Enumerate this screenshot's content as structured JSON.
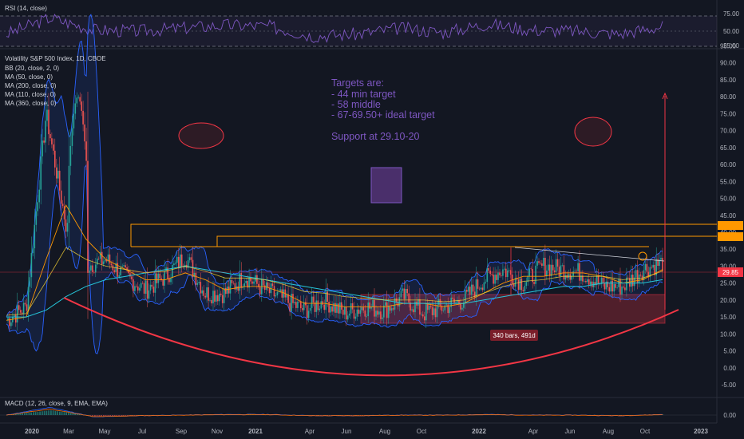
{
  "rsi_panel": {
    "legend": "RSI (14, close)",
    "ticks": [
      "75.00",
      "50.00",
      "25.00"
    ]
  },
  "main_panel": {
    "legend_title": "Volatility S&P 500 Index, 1D, CBOE",
    "indicators": [
      "BB (20, close, 2, 0)",
      "MA (50, close, 0)",
      "MA (200, close, 0)",
      "MA (110, close, 0)",
      "MA (360, close, 0)"
    ],
    "annotation_lines": [
      "Targets are:",
      "- 44 min target",
      "- 58 middle",
      "- 67-69.50+ ideal target",
      "",
      "Support at 29.10-20"
    ],
    "range_label": "340 bars, 491d",
    "price_tags": [
      {
        "text": "29.85",
        "color": "#f23645"
      },
      {
        "text": "",
        "color": "#ff9800"
      },
      {
        "text": "",
        "color": "#ff9800"
      }
    ]
  },
  "macd_panel": {
    "legend": "MACD (12, 26, close, 9, EMA, EMA)",
    "tick": "0.00"
  },
  "x_axis": {
    "labels": [
      "2020",
      "Mar",
      "May",
      "Jul",
      "Sep",
      "Nov",
      "2021",
      "Apr",
      "Jun",
      "Aug",
      "Oct",
      "2022",
      "Apr",
      "Jun",
      "Aug",
      "Oct",
      "2023"
    ]
  },
  "colors": {
    "background": "#131722",
    "axis_text": "#b2b5be",
    "annotation": "#7e57c2",
    "resistance": "#ff9800",
    "support_arc": "#f23645",
    "bollinger": "#2962ff",
    "up_candle": "#26a69a",
    "down_candle": "#ef5350"
  },
  "chart_data": [
    {
      "type": "line",
      "title": "",
      "legend": [
        "RSI (14, close)"
      ],
      "ylim": [
        20,
        85
      ],
      "yticks": [
        75,
        50,
        25
      ],
      "series": [
        {
          "name": "RSI (14, close)",
          "x": [
            "2020-01",
            "2020-03",
            "2020-05",
            "2020-07",
            "2020-09",
            "2020-11",
            "2021-01",
            "2021-04",
            "2021-06",
            "2021-08",
            "2021-10",
            "2022-01",
            "2022-04",
            "2022-06",
            "2022-08",
            "2022-10"
          ],
          "y": [
            45,
            72,
            52,
            50,
            55,
            60,
            58,
            42,
            45,
            55,
            48,
            62,
            52,
            50,
            45,
            58
          ]
        }
      ]
    },
    {
      "type": "line",
      "title": "Volatility S&P 500 Index, 1D, CBOE",
      "ylim": [
        -5,
        95
      ],
      "yticks": [
        95,
        90,
        85,
        80,
        75,
        70,
        65,
        60,
        55,
        50,
        45,
        40,
        35,
        30,
        25,
        20,
        15,
        10,
        5,
        0,
        -5
      ],
      "x": [
        "2020-01",
        "2020-02",
        "2020-03",
        "2020-04",
        "2020-05",
        "2020-06",
        "2020-07",
        "2020-08",
        "2020-09",
        "2020-10",
        "2020-11",
        "2020-12",
        "2021-01",
        "2021-02",
        "2021-03",
        "2021-04",
        "2021-05",
        "2021-06",
        "2021-07",
        "2021-08",
        "2021-09",
        "2021-10",
        "2021-11",
        "2021-12",
        "2022-01",
        "2022-02",
        "2022-03",
        "2022-04",
        "2022-05",
        "2022-06",
        "2022-07",
        "2022-08",
        "2022-09",
        "2022-10"
      ],
      "series": [
        {
          "name": "Volatility S&P 500 Index",
          "values": [
            14,
            18,
            75,
            42,
            30,
            32,
            27,
            23,
            27,
            33,
            22,
            22,
            27,
            23,
            20,
            17,
            20,
            16,
            18,
            17,
            21,
            16,
            18,
            20,
            26,
            29,
            25,
            30,
            29,
            28,
            24,
            24,
            29,
            31
          ]
        },
        {
          "name": "MA (50, close, 0)",
          "values": [
            14,
            15,
            32,
            48,
            38,
            32,
            29,
            26,
            26,
            28,
            26,
            23,
            24,
            24,
            22,
            19,
            19,
            18,
            18,
            18,
            19,
            19,
            18,
            19,
            22,
            25,
            27,
            27,
            28,
            28,
            27,
            25,
            26,
            29
          ]
        },
        {
          "name": "MA (200, close, 0)",
          "values": [
            15,
            15,
            17,
            21,
            24,
            26,
            27,
            28,
            29,
            30,
            29,
            28,
            27,
            26,
            25,
            24,
            23,
            22,
            21,
            20,
            19,
            19,
            19,
            19,
            20,
            21,
            22,
            23,
            24,
            24,
            25,
            25,
            25,
            26
          ]
        }
      ],
      "annotations": {
        "resistance_levels": [
          44,
          38
        ],
        "support_zone": [
          14,
          22
        ],
        "range_label": "340 bars, 491d"
      }
    },
    {
      "type": "line",
      "title": "",
      "legend": [
        "MACD (12, 26, close, 9, EMA, EMA)"
      ],
      "yticks": [
        0.0
      ],
      "series": [
        {
          "name": "MACD (12, 26, close, 9, EMA, EMA)",
          "x": [
            "2020-01",
            "2020-03",
            "2020-05",
            "2020-07",
            "2020-09",
            "2020-11",
            "2021-01",
            "2021-04",
            "2021-06",
            "2021-08",
            "2021-10",
            "2022-01",
            "2022-04",
            "2022-06",
            "2022-08",
            "2022-10"
          ],
          "y": [
            0,
            12,
            -3,
            -1,
            0,
            1,
            1,
            -1,
            -1,
            0,
            0,
            1,
            0,
            0,
            -1,
            1
          ]
        }
      ]
    }
  ]
}
